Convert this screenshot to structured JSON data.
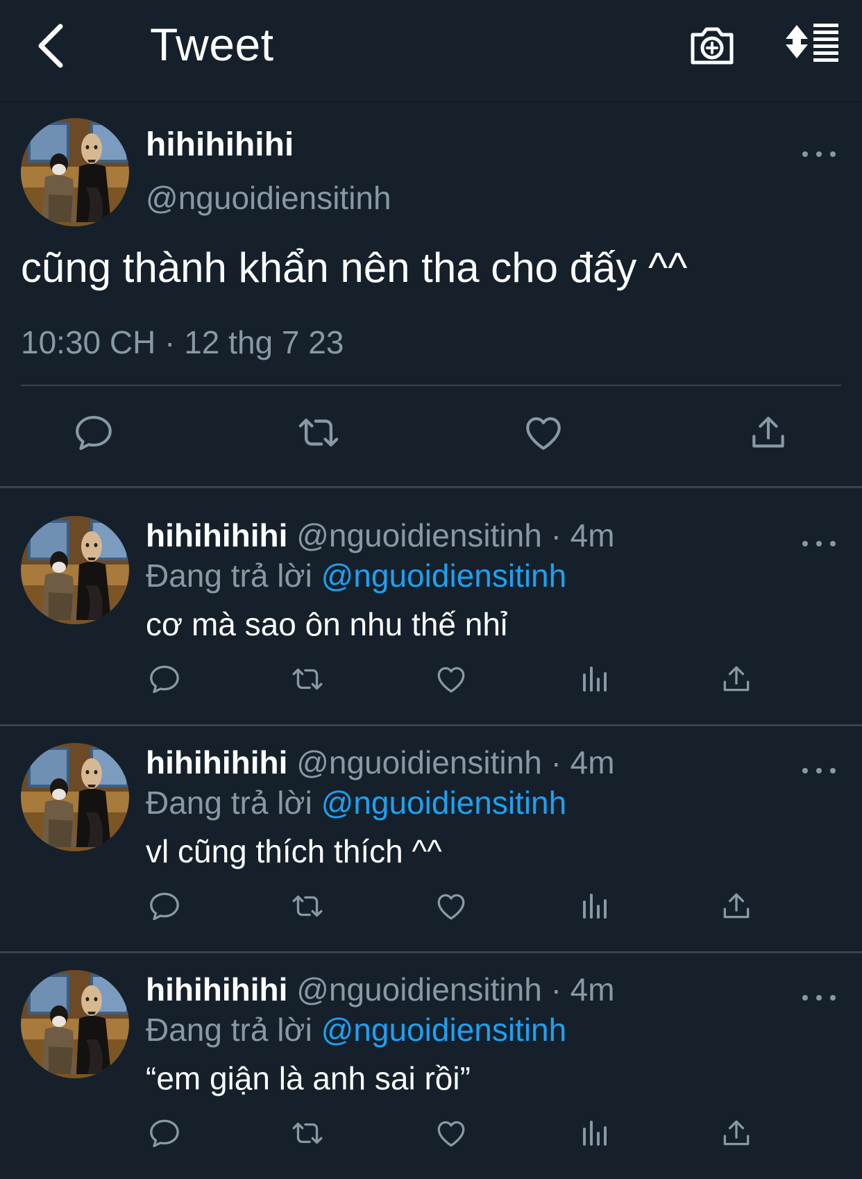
{
  "header": {
    "title": "Tweet"
  },
  "main_tweet": {
    "name": "hihihihihi",
    "handle": "@nguoidiensitinh",
    "text": "cũng thành khẩn nên tha cho đấy ^^",
    "timestamp": "10:30 CH · 12 thg 7 23"
  },
  "replies": [
    {
      "name": "hihihihihi",
      "handle": "@nguoidiensitinh",
      "time": " · 4m",
      "replying_prefix": "Đang trả lời ",
      "replying_to": "@nguoidiensitinh",
      "text": "cơ mà sao ôn nhu thế nhỉ"
    },
    {
      "name": "hihihihihi",
      "handle": "@nguoidiensitinh",
      "time": " · 4m",
      "replying_prefix": "Đang trả lời ",
      "replying_to": "@nguoidiensitinh",
      "text": "vl cũng thích thích ^^"
    },
    {
      "name": "hihihihihi",
      "handle": "@nguoidiensitinh",
      "time": " · 4m",
      "replying_prefix": "Đang trả lời ",
      "replying_to": "@nguoidiensitinh",
      "text": "“em giận là anh sai rồi”"
    }
  ],
  "colors": {
    "background": "#15202b",
    "secondary_text": "#8899a6",
    "link": "#1da1f2",
    "divider": "#38444d"
  },
  "icons": {
    "back": "chevron-left-icon",
    "camera": "camera-plus-icon",
    "sort": "sort-list-icon",
    "reply": "reply-icon",
    "retweet": "retweet-icon",
    "like": "heart-icon",
    "analytics": "analytics-icon",
    "share": "share-icon",
    "more": "more-icon"
  }
}
